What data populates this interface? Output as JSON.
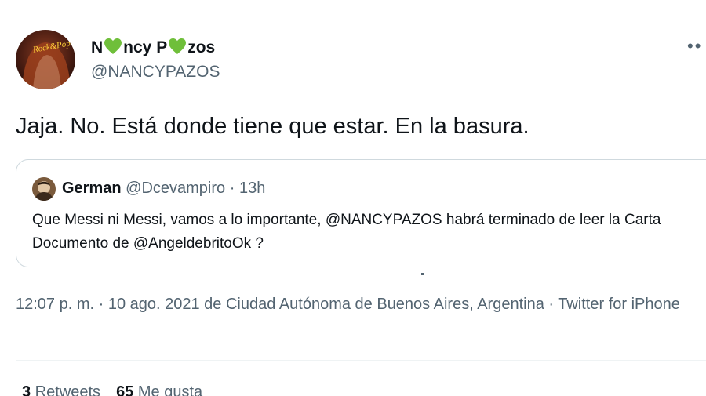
{
  "author": {
    "name_parts": [
      "N",
      "ncy P",
      "zos"
    ],
    "handle": "@NANCYPAZOS",
    "avatar_label": "Rock&Pop"
  },
  "icons": {
    "heart": "green-heart-icon",
    "more": "more-options-icon"
  },
  "colors": {
    "heart": "#6fbf3a",
    "secondary_text": "#536471",
    "border": "#cfd9de"
  },
  "tweet": {
    "text": "Jaja. No. Está donde tiene que estar. En la basura."
  },
  "quote": {
    "name": "German",
    "handle": "@Dcevampiro",
    "separator": "·",
    "time": "13h",
    "body_1": "Que Messi ni Messi, vamos a lo importante, ",
    "mention_1": "@NANCYPAZOS",
    "body_2": " habrá terminado de leer la Carta Documento de ",
    "mention_2": "@AngeldebritoOk",
    "body_3": " ?"
  },
  "meta": {
    "time": "12:07 p. m.",
    "sep1": " · ",
    "date": "10 ago. 2021",
    "location": " de Ciudad Autónoma de Buenos Aires, Argentina",
    "sep2": " · ",
    "source": "Twitter for iPhone"
  },
  "stats": {
    "retweets_count": "3",
    "retweets_label": " Retweets",
    "likes_count": "65",
    "likes_label": " Me gusta"
  }
}
